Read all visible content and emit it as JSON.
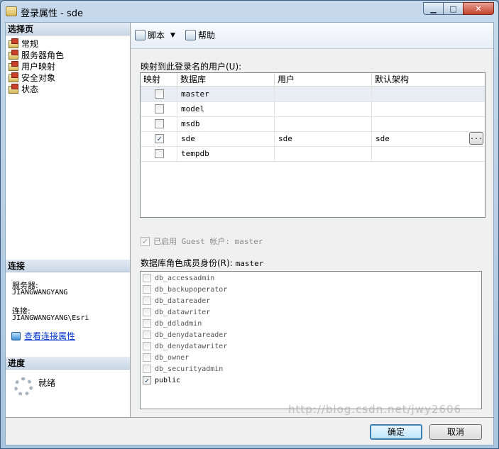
{
  "window": {
    "title": "登录属性 - sde",
    "buttons": {
      "minimize": "▁",
      "maximize": "□",
      "close": "✕"
    }
  },
  "sidebar": {
    "select_page_header": "选择页",
    "items": [
      {
        "label": "常规",
        "icon": "page-icon"
      },
      {
        "label": "服务器角色",
        "icon": "page-icon"
      },
      {
        "label": "用户映射",
        "icon": "page-icon"
      },
      {
        "label": "安全对象",
        "icon": "page-icon"
      },
      {
        "label": "状态",
        "icon": "page-icon"
      }
    ],
    "connection_header": "连接",
    "server_label": "服务器:",
    "server_value": "JIANGWANGYANG",
    "connection_label": "连接:",
    "connection_value": "JIANGWANGYANG\\Esri",
    "view_connection_link": "查看连接属性",
    "progress_header": "进度",
    "progress_status": "就绪"
  },
  "toolbar": {
    "script_label": "脚本",
    "dropdown_arrow": "▼",
    "help_label": "帮助"
  },
  "mapping": {
    "label": "映射到此登录名的用户(U):",
    "columns": [
      "映射",
      "数据库",
      "用户",
      "默认架构"
    ],
    "rows": [
      {
        "mapped": false,
        "database": "master",
        "user": "",
        "schema": ""
      },
      {
        "mapped": false,
        "database": "model",
        "user": "",
        "schema": ""
      },
      {
        "mapped": false,
        "database": "msdb",
        "user": "",
        "schema": ""
      },
      {
        "mapped": true,
        "database": "sde",
        "user": "sde",
        "schema": "sde"
      },
      {
        "mapped": false,
        "database": "tempdb",
        "user": "",
        "schema": ""
      }
    ],
    "ellipsis": "..."
  },
  "guest": {
    "label": "已启用 Guest 帐户: master",
    "checked": true
  },
  "roles": {
    "label": "数据库角色成员身份(R):",
    "database": "master",
    "items": [
      {
        "name": "db_accessadmin",
        "checked": false
      },
      {
        "name": "db_backupoperator",
        "checked": false
      },
      {
        "name": "db_datareader",
        "checked": false
      },
      {
        "name": "db_datawriter",
        "checked": false
      },
      {
        "name": "db_ddladmin",
        "checked": false
      },
      {
        "name": "db_denydatareader",
        "checked": false
      },
      {
        "name": "db_denydatawriter",
        "checked": false
      },
      {
        "name": "db_owner",
        "checked": false
      },
      {
        "name": "db_securityadmin",
        "checked": false
      },
      {
        "name": "public",
        "checked": true
      }
    ]
  },
  "footer": {
    "ok_label": "确定",
    "cancel_label": "取消"
  },
  "watermark": "http://blog.csdn.net/jwy2606"
}
